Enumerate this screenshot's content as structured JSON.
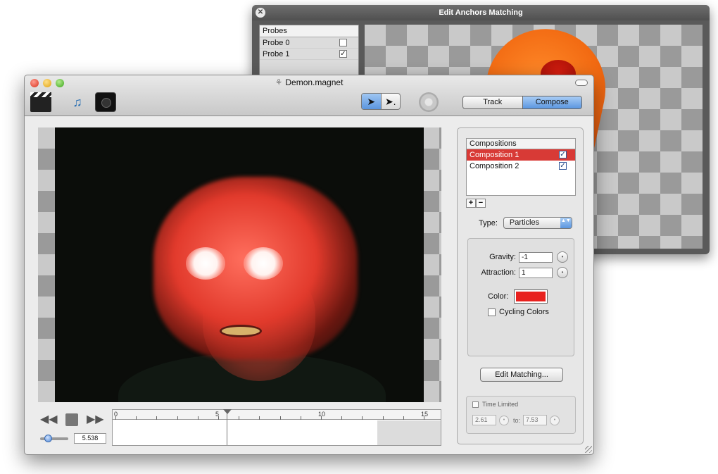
{
  "anchors_window": {
    "title": "Edit Anchors Matching",
    "close_glyph": "✕",
    "probes": {
      "header": "Probes",
      "items": [
        {
          "label": "Probe 0",
          "checked": false,
          "check_glyph": ""
        },
        {
          "label": "Probe 1",
          "checked": true,
          "check_glyph": "✓"
        }
      ]
    }
  },
  "main_window": {
    "title": "Demon.magnet",
    "title_icon": "document-icon",
    "toolbar": {
      "icons": [
        "clapperboard-icon",
        "media-browser-icon",
        "camera-icon"
      ],
      "pointer_tools": {
        "select": "➤",
        "subselect": "➤."
      },
      "mode_tabs": {
        "track": "Track",
        "compose": "Compose",
        "selected": "Compose"
      }
    },
    "timeline": {
      "time_display": "5.538",
      "ruler_labels": [
        "0",
        "5",
        "10",
        "15"
      ],
      "transport": {
        "rewind": "◀◀",
        "ffwd": "▶▶"
      }
    },
    "inspector": {
      "compositions_header": "Compositions",
      "compositions": [
        {
          "label": "Composition 1",
          "selected": true,
          "checked": true,
          "check_glyph": "✓"
        },
        {
          "label": "Composition 2",
          "selected": false,
          "checked": true,
          "check_glyph": "✓"
        }
      ],
      "add_label": "+",
      "remove_label": "−",
      "type_label": "Type:",
      "type_value": "Particles",
      "type_arrows": "▲▼",
      "gravity_label": "Gravity:",
      "gravity_value": "-1",
      "attraction_label": "Attraction:",
      "attraction_value": "1",
      "color_label": "Color:",
      "color_value": "#e8211e",
      "cycling_label": "Cycling Colors",
      "cycling_checked": false,
      "edit_matching_label": "Edit Matching...",
      "time_limited_label": "Time Limited",
      "time_limited_checked": false,
      "time_from": "2.61",
      "to_label": "to:",
      "time_to": "7.53"
    }
  }
}
